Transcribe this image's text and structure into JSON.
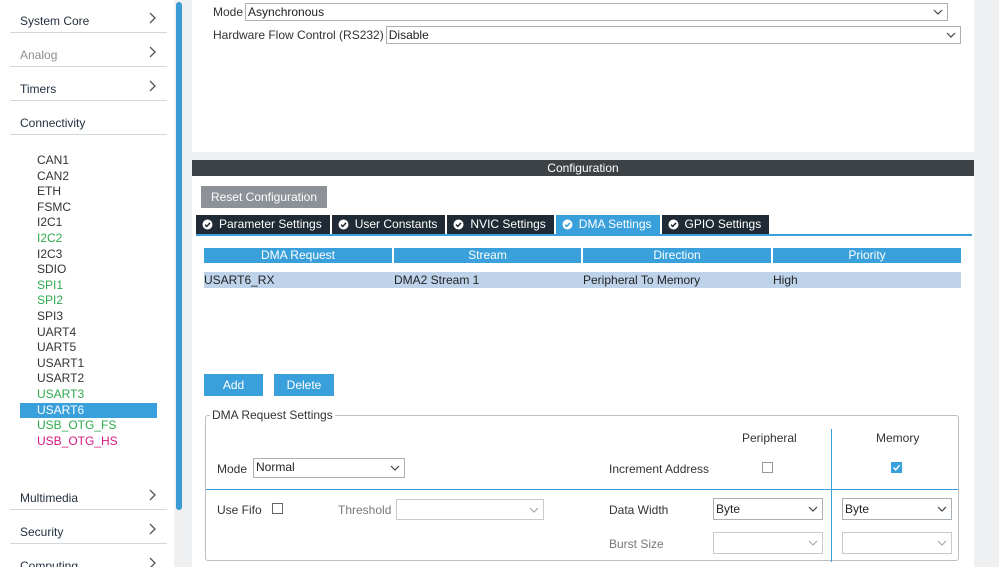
{
  "sidebar": {
    "categories": [
      {
        "label": "System Core"
      },
      {
        "label": "Analog"
      },
      {
        "label": "Timers"
      },
      {
        "label": "Connectivity"
      },
      {
        "label": "Multimedia"
      },
      {
        "label": "Security"
      },
      {
        "label": "Computing"
      }
    ],
    "items": [
      {
        "label": "CAN1"
      },
      {
        "label": "CAN2"
      },
      {
        "label": "ETH"
      },
      {
        "label": "FSMC"
      },
      {
        "label": "I2C1"
      },
      {
        "label": "I2C2"
      },
      {
        "label": "I2C3"
      },
      {
        "label": "SDIO"
      },
      {
        "label": "SPI1"
      },
      {
        "label": "SPI2"
      },
      {
        "label": "SPI3"
      },
      {
        "label": "UART4"
      },
      {
        "label": "UART5"
      },
      {
        "label": "USART1"
      },
      {
        "label": "USART2"
      },
      {
        "label": "USART3"
      },
      {
        "label": "USART6"
      },
      {
        "label": "USB_OTG_FS"
      },
      {
        "label": "USB_OTG_HS"
      }
    ]
  },
  "mode_panel": {
    "mode_label": "Mode",
    "mode_value": "Asynchronous",
    "flow_label": "Hardware Flow Control (RS232)",
    "flow_value": "Disable"
  },
  "config": {
    "header": "Configuration",
    "reset_label": "Reset Configuration",
    "tabs": [
      {
        "label": "Parameter Settings"
      },
      {
        "label": "User Constants"
      },
      {
        "label": "NVIC Settings"
      },
      {
        "label": "DMA Settings"
      },
      {
        "label": "GPIO Settings"
      }
    ]
  },
  "dma_table": {
    "headers": [
      "DMA Request",
      "Stream",
      "Direction",
      "Priority"
    ],
    "rows": [
      [
        "USART6_RX",
        "DMA2 Stream 1",
        "Peripheral To Memory",
        "High"
      ]
    ]
  },
  "buttons": {
    "add": "Add",
    "delete": "Delete"
  },
  "request_settings": {
    "legend": "DMA Request Settings",
    "peripheral_header": "Peripheral",
    "memory_header": "Memory",
    "mode_label": "Mode",
    "mode_value": "Normal",
    "increment_label": "Increment Address",
    "increment_peripheral": false,
    "increment_memory": true,
    "use_fifo_label": "Use Fifo",
    "use_fifo": false,
    "threshold_label": "Threshold",
    "threshold_value": "",
    "data_width_label": "Data Width",
    "data_width_peripheral": "Byte",
    "data_width_memory": "Byte",
    "burst_label": "Burst Size",
    "burst_peripheral": "",
    "burst_memory": ""
  },
  "colors": {
    "accent": "#39a0dc",
    "tab_inactive": "#1f2a34",
    "header_bar": "#3d4246",
    "selected_row": "#bed3ea",
    "item_green": "#2eaa4f",
    "item_pink": "#d6187e"
  }
}
